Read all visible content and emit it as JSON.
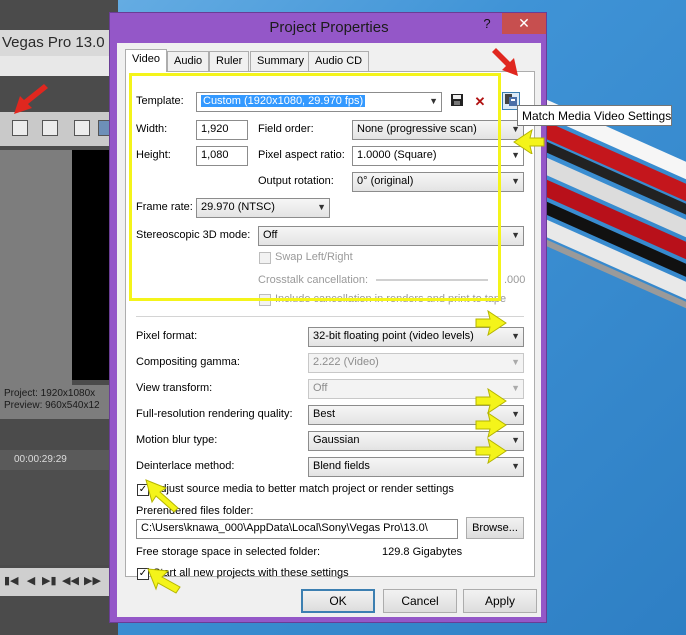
{
  "app": {
    "title": "Vegas Pro 13.0",
    "project_info": "Project:   1920x1080x",
    "preview_info": "Preview:  960x540x12",
    "timecode": "00:00:29:29"
  },
  "dialog": {
    "title": "Project Properties",
    "help": "?",
    "close": "✕",
    "tabs": [
      "Video",
      "Audio",
      "Ruler",
      "Summary",
      "Audio CD"
    ],
    "template_label": "Template:",
    "template_value": "Custom (1920x1080, 29.970 fps)",
    "width_label": "Width:",
    "width_value": "1,920",
    "height_label": "Height:",
    "height_value": "1,080",
    "field_order_label": "Field order:",
    "field_order_value": "None (progressive scan)",
    "par_label": "Pixel aspect ratio:",
    "par_value": "1.0000 (Square)",
    "rotation_label": "Output rotation:",
    "rotation_value": "0° (original)",
    "frame_rate_label": "Frame rate:",
    "frame_rate_value": "29.970 (NTSC)",
    "stereo_label": "Stereoscopic 3D mode:",
    "stereo_value": "Off",
    "swap_label": "Swap Left/Right",
    "crosstalk_label": "Crosstalk cancellation:",
    "crosstalk_value": ".000",
    "include_cancel_label": "Include cancellation in renders and print to tape",
    "pixel_format_label": "Pixel format:",
    "pixel_format_value": "32-bit floating point (video levels)",
    "gamma_label": "Compositing gamma:",
    "gamma_value": "2.222 (Video)",
    "view_transform_label": "View transform:",
    "view_transform_value": "Off",
    "fullres_label": "Full-resolution rendering quality:",
    "fullres_value": "Best",
    "motion_blur_label": "Motion blur type:",
    "motion_blur_value": "Gaussian",
    "deinterlace_label": "Deinterlace method:",
    "deinterlace_value": "Blend fields",
    "adjust_label": "Adjust source media to better match project or render settings",
    "prerendered_label": "Prerendered files folder:",
    "prerendered_value": "C:\\Users\\knawa_000\\AppData\\Local\\Sony\\Vegas Pro\\13.0\\",
    "browse_label": "Browse...",
    "free_storage_label": "Free storage space in selected folder:",
    "free_storage_value": "129.8 Gigabytes",
    "start_all_label": "Start all new projects with these settings",
    "ok_label": "OK",
    "cancel_label": "Cancel",
    "apply_label": "Apply"
  },
  "tooltip": "Match Media Video Settings",
  "colors": {
    "dialog_frame": "#9457c8",
    "close_button": "#c74f4f",
    "highlight_box": "#f4f41a",
    "annotation_arrow_red": "#e0271f",
    "annotation_arrow_yellow": "#f4f41a",
    "selection": "#3399ff"
  }
}
